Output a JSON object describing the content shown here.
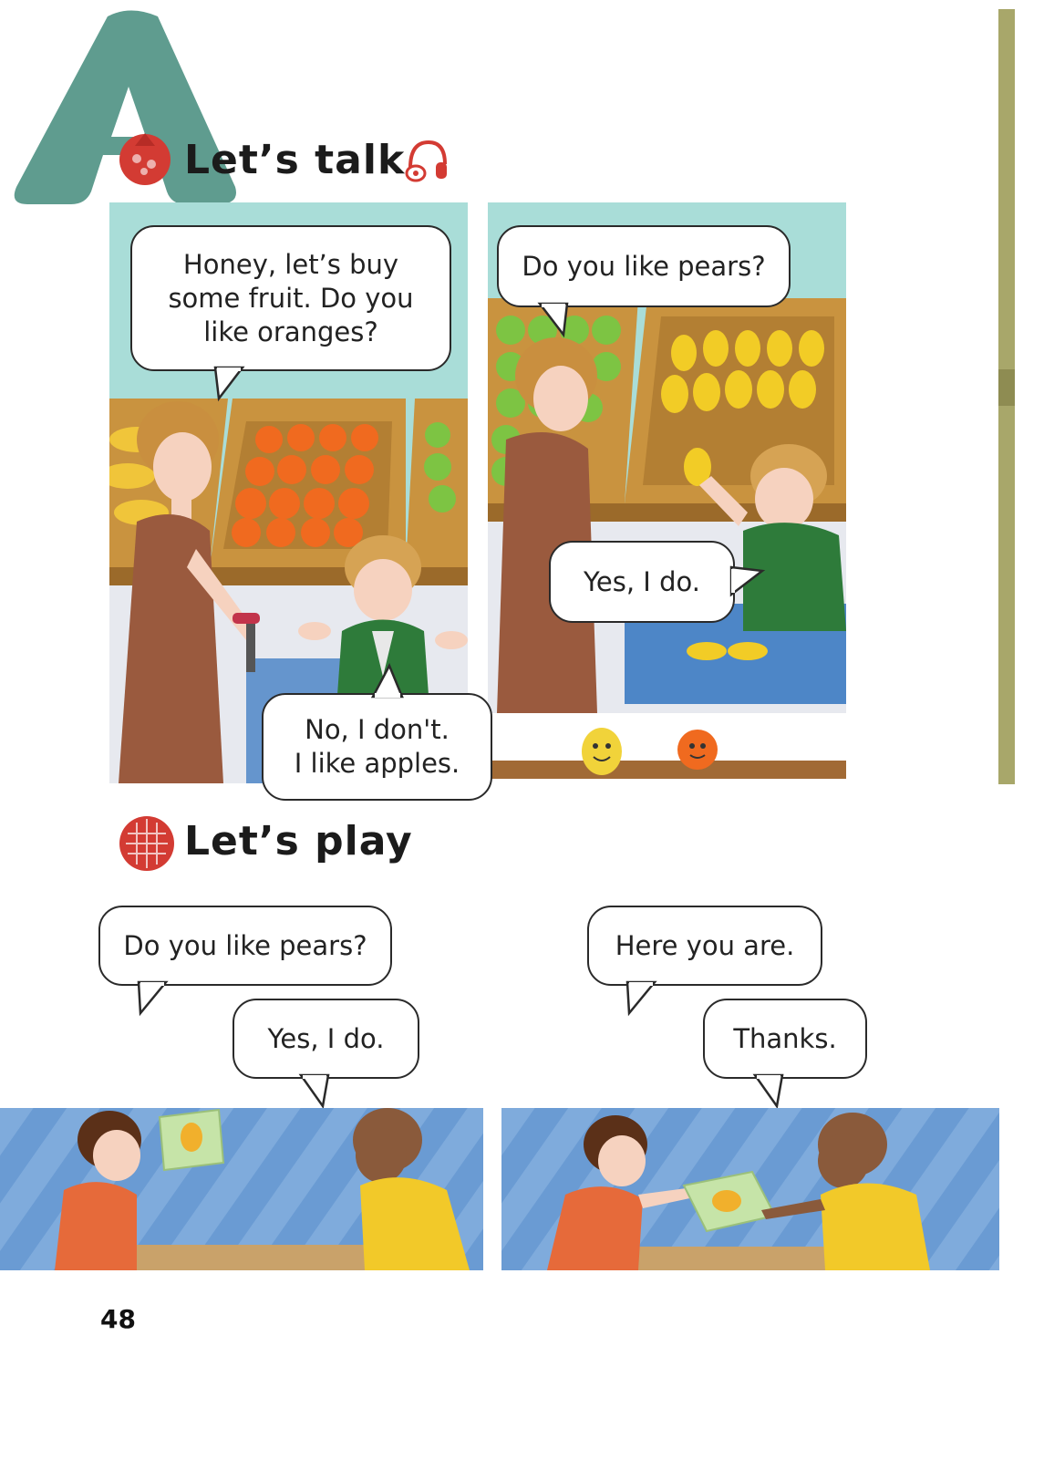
{
  "section_letter": "A",
  "talk": {
    "heading": "Let’s talk",
    "bubble1": "Honey, let’s buy\nsome fruit. Do you\nlike oranges?",
    "bubble2": "No, I don't.\nI like apples.",
    "bubble3": "Do you like pears?",
    "bubble4": "Yes, I do."
  },
  "play": {
    "heading": "Let’s play",
    "bubble1": "Do you like pears?",
    "bubble2": "Yes, I do.",
    "bubble3": "Here you are.",
    "bubble4": "Thanks."
  },
  "page_number": "48",
  "colors": {
    "letter_a": "#5f9c8f",
    "sidebar": "#a8a76a",
    "play_bg": "#6a9bd3",
    "icon_red": "#d33b33"
  },
  "icons": [
    "pomegranate-icon",
    "headphones-icon",
    "waffle-icon"
  ]
}
